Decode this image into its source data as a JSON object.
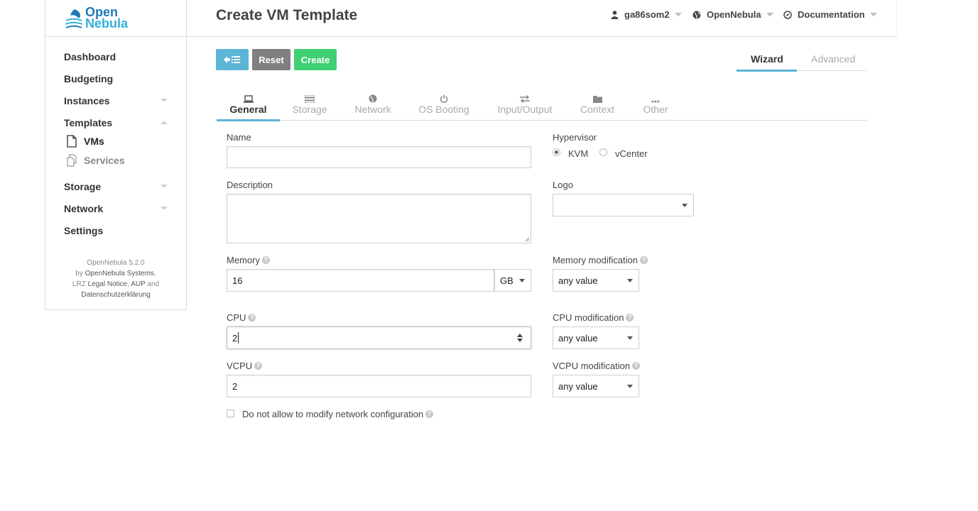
{
  "logo": {
    "line1": "Open",
    "line2": "Nebula"
  },
  "sidebar": {
    "items": [
      {
        "label": "Dashboard"
      },
      {
        "label": "Budgeting"
      },
      {
        "label": "Instances"
      },
      {
        "label": "Templates"
      },
      {
        "label": "Storage"
      },
      {
        "label": "Network"
      },
      {
        "label": "Settings"
      }
    ],
    "sub_items": [
      {
        "label": "VMs"
      },
      {
        "label": "Services"
      }
    ],
    "footer": {
      "version": "OpenNebula 5.2.0",
      "by": "by",
      "company": "OpenNebula Systems",
      "comma": ",",
      "lrz": "LRZ",
      "legal": "Legal Notice",
      "comma2": ",",
      "aup": "AUP",
      "and": "and",
      "privacy": "Datenschutzerklärung"
    }
  },
  "header": {
    "title": "Create VM Template",
    "user": "ga86som2",
    "zone": "OpenNebula",
    "docs": "Documentation"
  },
  "toolbar": {
    "back_icon": "arrow-left-list-icon",
    "reset_label": "Reset",
    "create_label": "Create",
    "colors": {
      "back": "#5bb5d6",
      "reset": "#808080",
      "create": "#3ecf72"
    }
  },
  "mode_tabs": {
    "wizard": "Wizard",
    "advanced": "Advanced"
  },
  "section_tabs": [
    {
      "label": "General",
      "icon": "laptop-icon"
    },
    {
      "label": "Storage",
      "icon": "tasks-icon"
    },
    {
      "label": "Network",
      "icon": "globe-icon"
    },
    {
      "label": "OS Booting",
      "icon": "power-icon"
    },
    {
      "label": "Input/Output",
      "icon": "exchange-icon"
    },
    {
      "label": "Context",
      "icon": "folder-icon"
    },
    {
      "label": "Other",
      "icon": "ellipsis-icon"
    }
  ],
  "form": {
    "name_label": "Name",
    "name_value": "",
    "hypervisor_label": "Hypervisor",
    "hypervisor_options": [
      "KVM",
      "vCenter"
    ],
    "hypervisor_selected": "KVM",
    "description_label": "Description",
    "description_value": "",
    "logo_label": "Logo",
    "logo_value": "",
    "memory_label": "Memory",
    "memory_value": "16",
    "memory_unit": "GB",
    "memory_mod_label": "Memory modification",
    "memory_mod_value": "any value",
    "cpu_label": "CPU",
    "cpu_value": "2",
    "cpu_mod_label": "CPU modification",
    "cpu_mod_value": "any value",
    "vcpu_label": "VCPU",
    "vcpu_value": "2",
    "vcpu_mod_label": "VCPU modification",
    "vcpu_mod_value": "any value",
    "network_lock_label": "Do not allow to modify network configuration",
    "help_glyph": "?"
  }
}
